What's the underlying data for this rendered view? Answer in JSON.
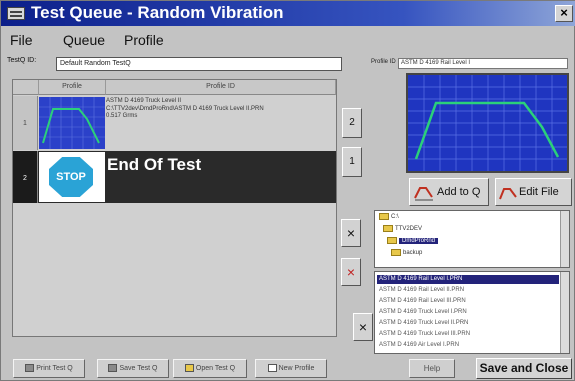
{
  "window": {
    "title": "Test Queue - Random Vibration",
    "close_glyph": "×"
  },
  "menu": [
    "File",
    "Queue",
    "Profile"
  ],
  "testq": {
    "label": "TestQ ID:",
    "value": "Default Random TestQ"
  },
  "profile_id": {
    "label": "Profile ID",
    "value": "ASTM D 4169 Rail Level I"
  },
  "grid": {
    "headers": [
      "Profile",
      "Profile ID"
    ],
    "rows": [
      {
        "num": "1",
        "desc": [
          "ASTM D 4169 Truck Level II",
          "C:\\TTV2dev\\DmdProRnd\\ASTM D 4169 Truck Level II.PRN",
          "0.517 Grms"
        ]
      },
      {
        "num": "2",
        "stop_text": "STOP",
        "text": "End Of Test"
      }
    ]
  },
  "side_buttons": {
    "up_label": "2",
    "down_label": "1",
    "remove1": "×",
    "remove2": "×",
    "remove3": "×"
  },
  "actions": {
    "add_to_q": "Add to Q",
    "edit_file": "Edit File"
  },
  "tree": [
    "C:\\",
    "TTV2DEV",
    "DmdProRnd",
    "backup"
  ],
  "files": [
    "ASTM D 4169 Rail Level I.PRN",
    "ASTM D 4169 Rail Level II.PRN",
    "ASTM D 4169 Rail Level III.PRN",
    "ASTM D 4169 Truck Level I.PRN",
    "ASTM D 4169 Truck Level II.PRN",
    "ASTM D 4169 Truck Level III.PRN",
    "ASTM D 4169 Air Level I.PRN"
  ],
  "bottom": {
    "print": "Print Test Q",
    "save": "Save Test Q",
    "open": "Open Test Q",
    "new_profile": "New Profile",
    "help": "Help",
    "save_close": "Save and Close"
  },
  "colors": {
    "title_bar": "#0c1f8a",
    "graph_bg": "#1f35c0",
    "curve": "#2bd07a",
    "stop_sign": "#2aa3d6",
    "selection": "#23237a"
  }
}
